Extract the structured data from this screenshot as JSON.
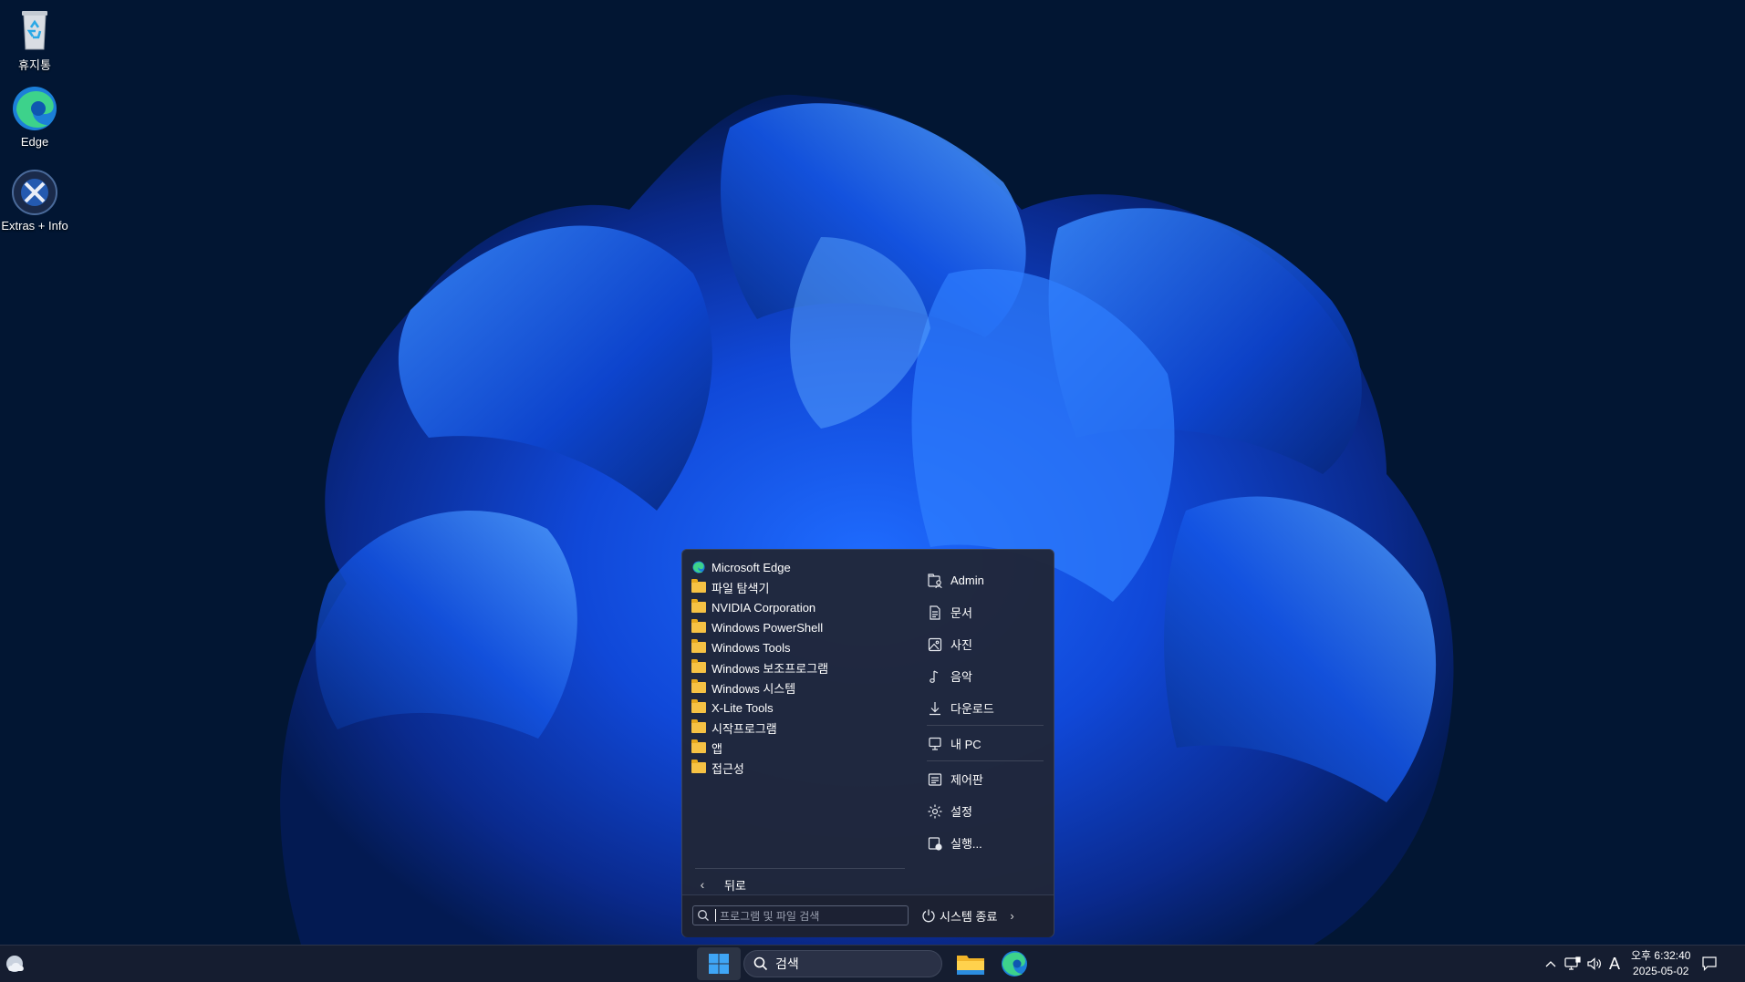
{
  "desktop": {
    "icons": [
      {
        "label": "휴지통",
        "icon": "recycle-bin-icon"
      },
      {
        "label": "Edge",
        "icon": "edge-icon"
      },
      {
        "label": "Extras + Info",
        "icon": "extras-info-icon"
      }
    ]
  },
  "start_menu": {
    "apps": [
      {
        "label": "Microsoft Edge",
        "icon": "edge-icon"
      },
      {
        "label": "파일 탐색기",
        "icon": "file-explorer-icon"
      },
      {
        "label": "NVIDIA Corporation",
        "icon": "folder-icon"
      },
      {
        "label": "Windows PowerShell",
        "icon": "folder-icon"
      },
      {
        "label": "Windows Tools",
        "icon": "folder-icon"
      },
      {
        "label": "Windows 보조프로그램",
        "icon": "folder-icon"
      },
      {
        "label": "Windows 시스템",
        "icon": "folder-icon"
      },
      {
        "label": "X-Lite Tools",
        "icon": "folder-icon"
      },
      {
        "label": "시작프로그램",
        "icon": "folder-icon"
      },
      {
        "label": "앱",
        "icon": "folder-icon"
      },
      {
        "label": "접근성",
        "icon": "folder-icon"
      }
    ],
    "back_label": "뒤로",
    "places": [
      {
        "label": "Admin",
        "icon": "user-folder-icon"
      },
      {
        "label": "문서",
        "icon": "document-icon"
      },
      {
        "label": "사진",
        "icon": "picture-icon"
      },
      {
        "label": "음악",
        "icon": "music-icon"
      },
      {
        "label": "다운로드",
        "icon": "download-icon"
      },
      {
        "label": "내 PC",
        "icon": "computer-icon"
      },
      {
        "label": "제어판",
        "icon": "control-panel-icon"
      },
      {
        "label": "설정",
        "icon": "gear-icon"
      },
      {
        "label": "실행...",
        "icon": "run-icon"
      }
    ],
    "search_placeholder": "프로그램 및 파일 검색",
    "power_label": "시스템 종료"
  },
  "taskbar": {
    "search_label": "검색",
    "ime_label": "A",
    "time": "오후 6:32:40",
    "date": "2025-05-02"
  },
  "colors": {
    "background": "#021633",
    "accent": "#1e7fe0",
    "folder": "#f6c244"
  }
}
